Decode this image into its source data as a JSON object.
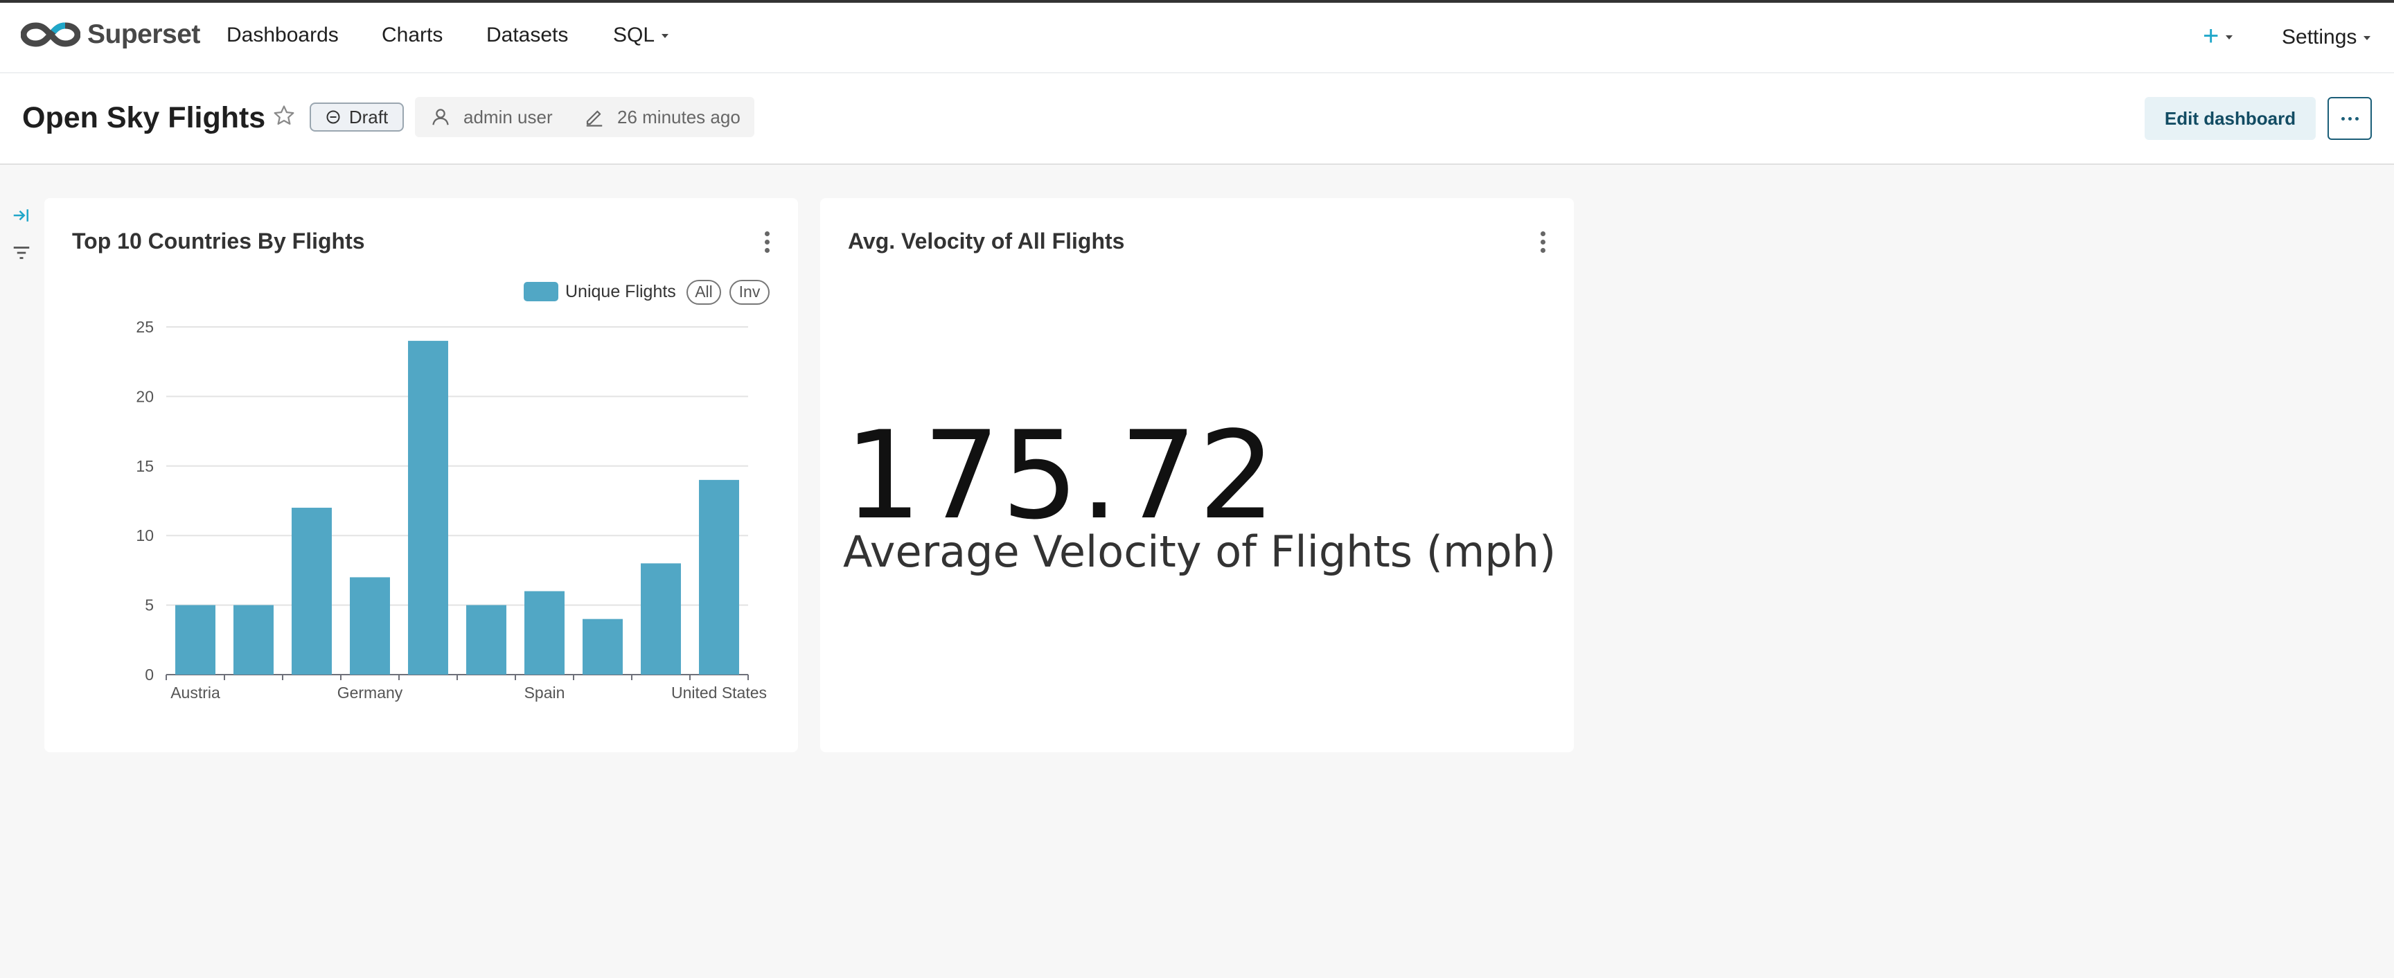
{
  "navbar": {
    "brand": "Superset",
    "items": [
      {
        "label": "Dashboards"
      },
      {
        "label": "Charts"
      },
      {
        "label": "Datasets"
      },
      {
        "label": "SQL"
      }
    ],
    "plus_label": "+",
    "settings_label": "Settings"
  },
  "header": {
    "title": "Open Sky Flights",
    "status_badge": "Draft",
    "owner": "admin user",
    "modified": "26 minutes ago",
    "edit_button": "Edit dashboard"
  },
  "charts": [
    {
      "title": "Top 10 Countries By Flights",
      "legend": {
        "series_name": "Unique Flights",
        "all_label": "All",
        "inv_label": "Inv"
      }
    },
    {
      "title": "Avg. Velocity of All Flights",
      "big_number": "175.72",
      "subtitle": "Average Velocity of Flights (mph)"
    }
  ],
  "chart_data": {
    "type": "bar",
    "categories": [
      "Austria",
      "",
      "",
      "Germany",
      "",
      "",
      "Spain",
      "",
      "",
      "United States"
    ],
    "visible_tick_labels": [
      "Austria",
      "Germany",
      "Spain",
      "United States"
    ],
    "series": [
      {
        "name": "Unique Flights",
        "values": [
          5,
          5,
          12,
          7,
          24,
          5,
          6,
          4,
          8,
          14
        ]
      }
    ],
    "ylim": [
      0,
      25
    ],
    "yticks": [
      0,
      5,
      10,
      15,
      20,
      25
    ],
    "grid": true,
    "legend_position": "top-right",
    "color": "#51a7c5"
  }
}
